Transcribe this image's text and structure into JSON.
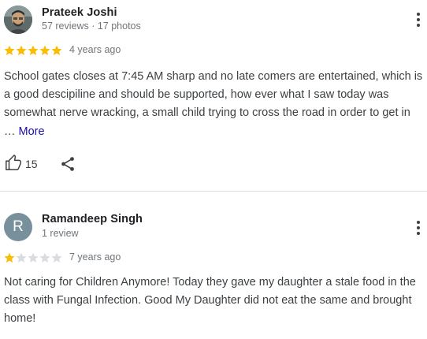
{
  "reviews": [
    {
      "name": "Prateek Joshi",
      "meta": "57 reviews · 17 photos",
      "rating": 5,
      "date": "4 years ago",
      "text": "School gates closes at 7:45 AM sharp and no late comers are entertained, which is a good descipiline and should be supported, how ever what I saw today was somewhat nerve wracking, a small child trying to cross the road in order to get in",
      "ellipsis": " … ",
      "more_label": "More",
      "likes": "15"
    },
    {
      "name": "Ramandeep Singh",
      "avatar_letter": "R",
      "meta": "1 review",
      "rating": 1,
      "date": "7 years ago",
      "text": "Not caring for Children Anymore! Today they gave my daughter a stale food in the class with Fungal Infection. Good My Daughter did not eat the same and brought home!"
    }
  ],
  "colors": {
    "star_filled": "#fbbc04",
    "star_empty": "#dadce0",
    "more_link": "#1a0dab",
    "avatar_letter_bg": "#78909c"
  },
  "icons": {
    "like": "thumbs-up-icon",
    "share": "share-icon",
    "menu": "more-vert-icon"
  }
}
